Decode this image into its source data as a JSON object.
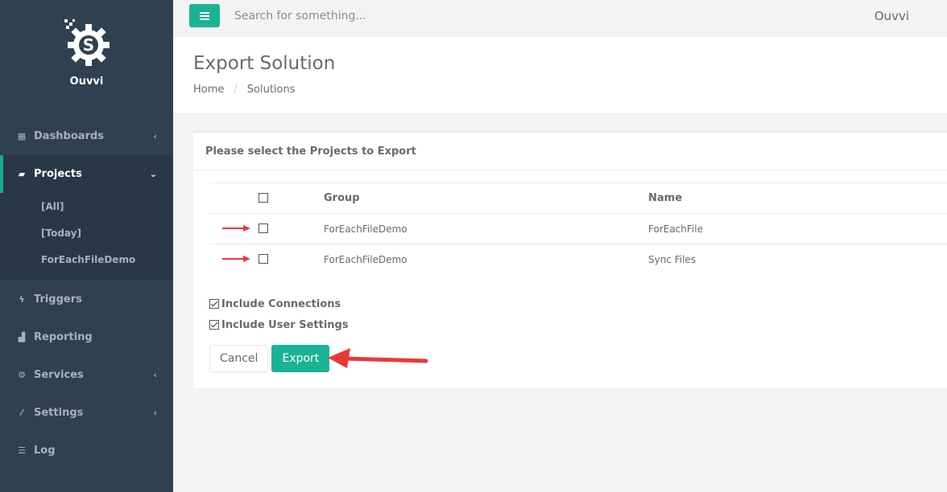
{
  "app": {
    "brand": "Ouvvi"
  },
  "sidebar": {
    "items": [
      {
        "label": "Dashboards",
        "icon": "grid-icon",
        "has_chevron": true,
        "chevron": "‹"
      },
      {
        "label": "Projects",
        "icon": "book-icon",
        "active": true,
        "chevron": "⌄",
        "children": [
          {
            "label": "[All]"
          },
          {
            "label": "[Today]"
          },
          {
            "label": "ForEachFileDemo"
          }
        ]
      },
      {
        "label": "Triggers",
        "icon": "bolt-icon"
      },
      {
        "label": "Reporting",
        "icon": "bar-chart-icon"
      },
      {
        "label": "Services",
        "icon": "cogs-icon",
        "chevron": "‹"
      },
      {
        "label": "Settings",
        "icon": "magic-wand-icon",
        "chevron": "‹"
      },
      {
        "label": "Log",
        "icon": "list-icon"
      }
    ]
  },
  "topbar": {
    "search_placeholder": "Search for something...",
    "user": "Ouvvi"
  },
  "heading": {
    "title": "Export Solution",
    "breadcrumb": [
      "Home",
      "Solutions"
    ],
    "separator": "/"
  },
  "panel": {
    "title": "Please select the Projects to Export",
    "columns": {
      "group": "Group",
      "name": "Name"
    },
    "rows": [
      {
        "group": "ForEachFileDemo",
        "name": "ForEachFile",
        "checked": false
      },
      {
        "group": "ForEachFileDemo",
        "name": "Sync Files",
        "checked": false
      }
    ],
    "options": [
      {
        "label": "Include Connections",
        "checked": true
      },
      {
        "label": "Include User Settings",
        "checked": true
      }
    ],
    "buttons": {
      "cancel": "Cancel",
      "export": "Export"
    }
  },
  "colors": {
    "accent": "#1ab394",
    "sidebar": "#2f4050",
    "annotation_arrow": "#e8393a"
  }
}
